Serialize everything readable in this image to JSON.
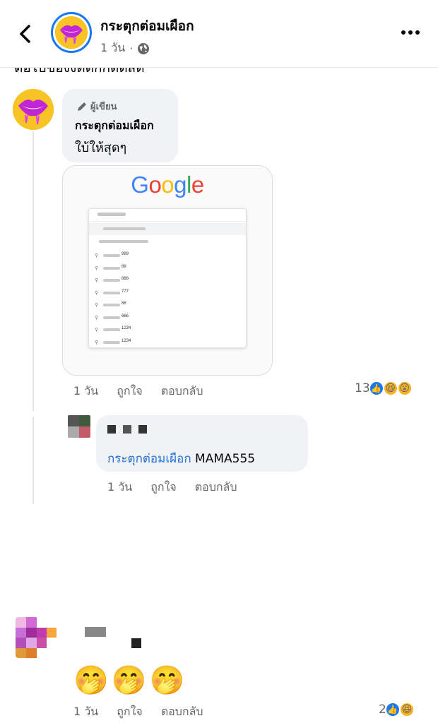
{
  "header": {
    "back_icon": "chevron-left-icon",
    "page_name": "กระตุกต่อมเผือก",
    "time": "1 วัน",
    "separator": "·",
    "privacy_icon": "globe-icon",
    "more_icon": "more-horizontal-icon"
  },
  "cut_text": "ต่อไปของงดดกกดดสด",
  "comment1": {
    "author_label": "ผู้เขียน",
    "author_icon": "pencil-icon",
    "name": "กระตุกต่อมเผือก",
    "text": "ใบ้ให้สุดๆ",
    "image": {
      "logo": "Google",
      "suggestions": [
        "999",
        "89",
        "888",
        "777",
        "88",
        "666",
        "1234",
        "1234"
      ]
    },
    "time": "1 วัน",
    "like": "ถูกใจ",
    "reply": "ตอบกลับ",
    "reaction_count": "13",
    "reactions": [
      "like",
      "haha",
      "wow"
    ]
  },
  "reply1": {
    "name_blurred": "■ ■ ■",
    "mention": "กระตุกต่อมเผือก",
    "text": "MAMA555",
    "time": "1 วัน",
    "like": "ถูกใจ",
    "reply": "ตอบกลับ"
  },
  "comment3": {
    "emojis": [
      "🤭",
      "🤭",
      "🤭"
    ],
    "time": "1 วัน",
    "like": "ถูกใจ",
    "reply": "ตอบกลับ",
    "reaction_count": "2",
    "reactions": [
      "like",
      "haha"
    ]
  },
  "colors": {
    "accent": "#1877f2",
    "mention": "#216fdb",
    "secondary_text": "#65676b",
    "bubble": "#f0f2f5"
  }
}
